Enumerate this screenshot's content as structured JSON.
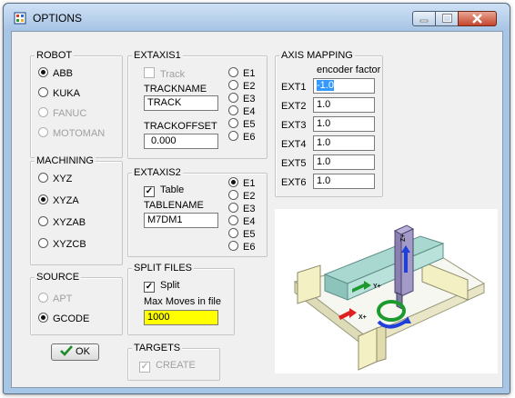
{
  "window": {
    "title": "OPTIONS"
  },
  "robot": {
    "label": "ROBOT",
    "options": [
      {
        "label": "ABB",
        "selected": true,
        "enabled": true
      },
      {
        "label": "KUKA",
        "selected": false,
        "enabled": true
      },
      {
        "label": "FANUC",
        "selected": false,
        "enabled": false
      },
      {
        "label": "MOTOMAN",
        "selected": false,
        "enabled": false
      }
    ]
  },
  "machining": {
    "label": "MACHINING",
    "options": [
      {
        "label": "XYZ",
        "selected": false
      },
      {
        "label": "XYZA",
        "selected": true
      },
      {
        "label": "XYZAB",
        "selected": false
      },
      {
        "label": "XYZCB",
        "selected": false
      }
    ]
  },
  "source": {
    "label": "SOURCE",
    "options": [
      {
        "label": "APT",
        "selected": false,
        "enabled": false
      },
      {
        "label": "GCODE",
        "selected": true,
        "enabled": true
      }
    ]
  },
  "ok_button": {
    "label": "OK",
    "icon": "checkmark-icon"
  },
  "extaxis1": {
    "label": "EXTAXIS1",
    "track_check": {
      "label": "Track",
      "checked": false,
      "enabled": false
    },
    "trackname_label": "TRACKNAME",
    "trackname_value": "TRACK",
    "trackoffset_label": "TRACKOFFSET",
    "trackoffset_value": "0.000",
    "axes": [
      {
        "label": "E1",
        "selected": false
      },
      {
        "label": "E2",
        "selected": false
      },
      {
        "label": "E3",
        "selected": false
      },
      {
        "label": "E4",
        "selected": false
      },
      {
        "label": "E5",
        "selected": false
      },
      {
        "label": "E6",
        "selected": false
      }
    ]
  },
  "extaxis2": {
    "label": "EXTAXIS2",
    "table_check": {
      "label": "Table",
      "checked": true
    },
    "tablename_label": "TABLENAME",
    "tablename_value": "M7DM1",
    "axes": [
      {
        "label": "E1",
        "selected": true
      },
      {
        "label": "E2",
        "selected": false
      },
      {
        "label": "E3",
        "selected": false
      },
      {
        "label": "E4",
        "selected": false
      },
      {
        "label": "E5",
        "selected": false
      },
      {
        "label": "E6",
        "selected": false
      }
    ]
  },
  "split_files": {
    "label": "SPLIT FILES",
    "split_check": {
      "label": "Split",
      "checked": true
    },
    "max_moves_label": "Max Moves in file",
    "max_moves_value": "1000",
    "highlight_color": "#ffff00"
  },
  "targets": {
    "label": "TARGETS",
    "create_check": {
      "label": "CREATE",
      "checked": true,
      "enabled": false
    }
  },
  "axis_mapping": {
    "label": "AXIS MAPPING",
    "column_header": "encoder factor",
    "rows": [
      {
        "label": "EXT1",
        "value": "-1.0",
        "selected_text": true
      },
      {
        "label": "EXT2",
        "value": "1.0"
      },
      {
        "label": "EXT3",
        "value": "1.0"
      },
      {
        "label": "EXT4",
        "value": "1.0"
      },
      {
        "label": "EXT5",
        "value": "1.0"
      },
      {
        "label": "EXT6",
        "value": "1.0"
      }
    ]
  },
  "machine_preview": {
    "axis_labels": [
      "Y+",
      "Z+",
      "X+"
    ],
    "colors": {
      "frame": "#f3f0c4",
      "rail": "#a9d8d0",
      "arrow_green": "#1d9a2e",
      "arrow_blue": "#1e3fd8",
      "arrow_red": "#e02020",
      "column": "#8a7fb0"
    }
  }
}
